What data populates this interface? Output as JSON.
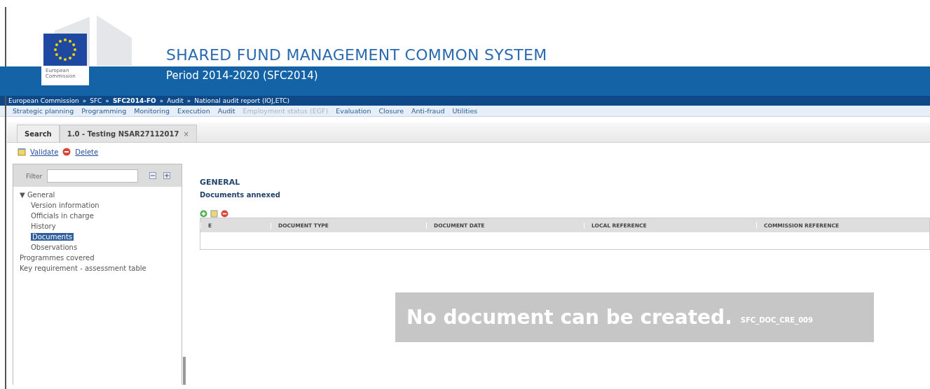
{
  "header": {
    "logo_caption": [
      "European",
      "Commission"
    ],
    "title": "SHARED FUND MANAGEMENT COMMON SYSTEM",
    "subtitle": "Period 2014-2020 (SFC2014)"
  },
  "breadcrumb": [
    {
      "label": "European Commission",
      "bold": false
    },
    {
      "label": "SFC",
      "bold": false
    },
    {
      "label": "SFC2014-FO",
      "bold": true
    },
    {
      "label": "Audit",
      "bold": false
    },
    {
      "label": "National audit report (IOJ,ETC)",
      "bold": false
    }
  ],
  "breadcrumb_separator": "»",
  "menu": [
    {
      "label": "Strategic planning",
      "disabled": false
    },
    {
      "label": "Programming",
      "disabled": false
    },
    {
      "label": "Monitoring",
      "disabled": false
    },
    {
      "label": "Execution",
      "disabled": false
    },
    {
      "label": "Audit",
      "disabled": false
    },
    {
      "label": "Employment status (EGF)",
      "disabled": true
    },
    {
      "label": "Evaluation",
      "disabled": false
    },
    {
      "label": "Closure",
      "disabled": false
    },
    {
      "label": "Anti-fraud",
      "disabled": false
    },
    {
      "label": "Utilities",
      "disabled": false
    }
  ],
  "tabs": [
    {
      "label": "Search",
      "selected": false,
      "closable": false
    },
    {
      "label": "1.0 - Testing NSAR27112017",
      "selected": true,
      "closable": true
    }
  ],
  "tab_close": "×",
  "toolbar": [
    {
      "label": "Validate",
      "kind": "validate"
    },
    {
      "label": "Delete",
      "kind": "delete"
    }
  ],
  "sidebar": {
    "filter_label": "Filter",
    "items": [
      {
        "label": "General",
        "expanded": true,
        "selected": false,
        "children": [
          {
            "label": "Version information",
            "selected": false
          },
          {
            "label": "Officials in charge",
            "selected": false
          },
          {
            "label": "History",
            "selected": false
          },
          {
            "label": "Documents",
            "selected": true
          },
          {
            "label": "Observations",
            "selected": false
          }
        ]
      },
      {
        "label": "Programmes covered",
        "selected": false
      },
      {
        "label": "Key requirement - assessment table",
        "selected": false
      }
    ],
    "expand_marker": "▼"
  },
  "section": {
    "title": "GENERAL",
    "subtitle": "Documents annexed"
  },
  "table": {
    "columns": [
      "E",
      "DOCUMENT TYPE",
      "DOCUMENT DATE",
      "LOCAL REFERENCE",
      "COMMISSION REFERENCE"
    ]
  },
  "message": {
    "text": "No document can be created.",
    "code": "SFC_DOC_CRE_009"
  }
}
